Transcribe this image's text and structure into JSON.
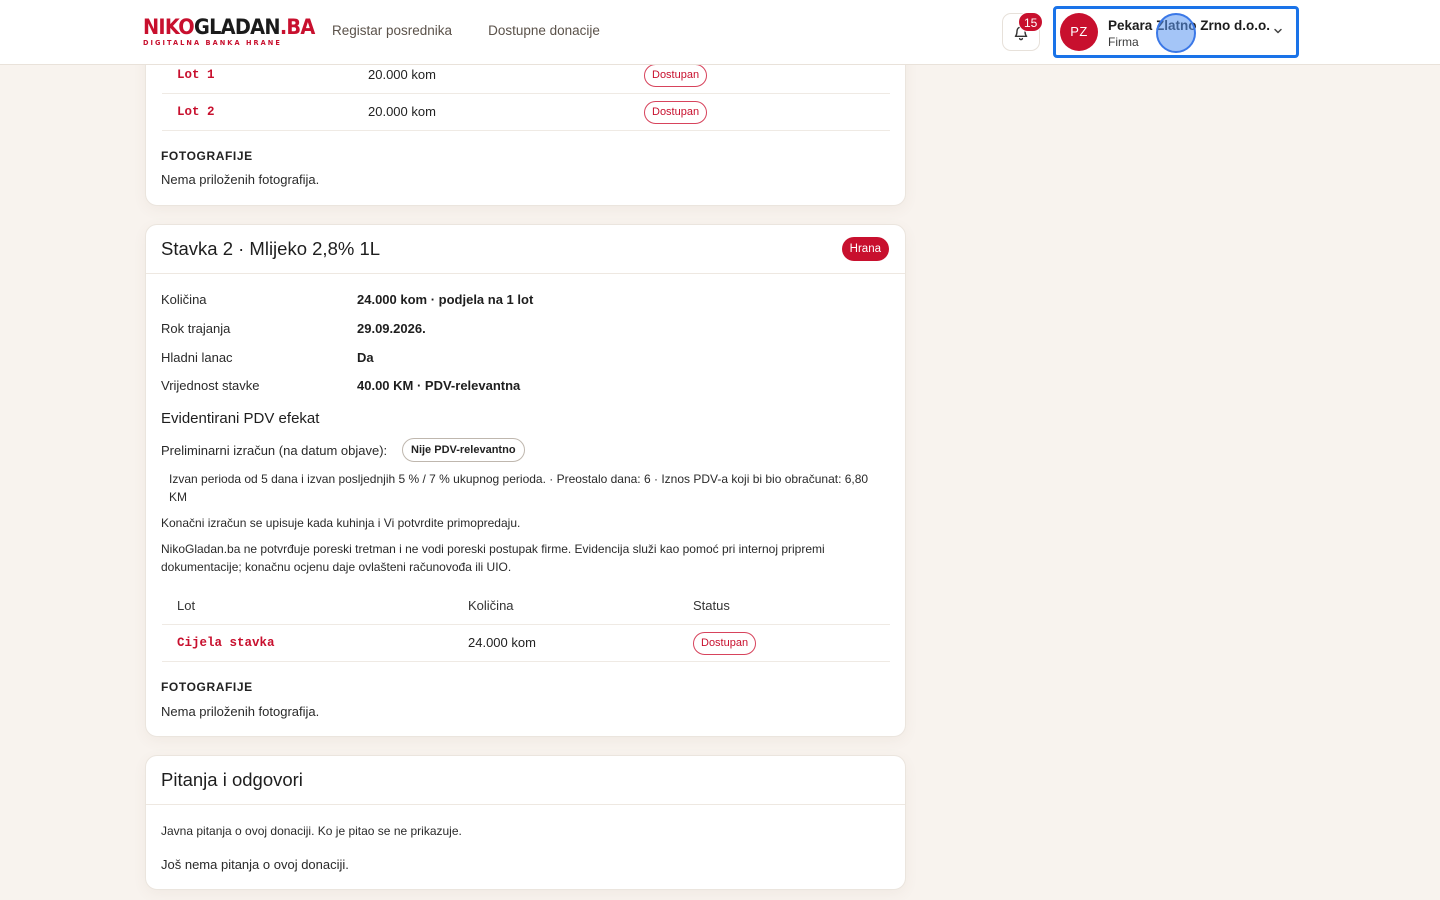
{
  "header": {
    "logo": {
      "part1": "NIKO",
      "part2": "GLADAN",
      "part3": ".BA",
      "tagline": "DIGITALNA BANKA HRANE"
    },
    "nav": [
      "Registar posrednika",
      "Dostupne donacije"
    ],
    "notifications": {
      "count": "15",
      "icon": "bell-icon"
    },
    "account": {
      "initials": "PZ",
      "name": "Pekara Zlatno Zrno d.o.o.",
      "role": "Firma"
    }
  },
  "item1": {
    "lots": [
      {
        "code": "Lot 1",
        "qty": "20.000 kom",
        "status": "Dostupan"
      },
      {
        "code": "Lot 2",
        "qty": "20.000 kom",
        "status": "Dostupan"
      }
    ],
    "photos_label": "FOTOGRAFIJE",
    "photos_text": "Nema priloženih fotografija."
  },
  "item2": {
    "title": "Stavka 2 · Mlijeko 2,8% 1L",
    "category": "Hrana",
    "details": [
      {
        "label": "Količina",
        "value": "24.000 kom · podjela na 1 lot"
      },
      {
        "label": "Rok trajanja",
        "value": "29.09.2026."
      },
      {
        "label": "Hladni lanac",
        "value": "Da"
      },
      {
        "label": "Vrijednost stavke",
        "value": "40.00 KM · PDV-relevantna"
      }
    ],
    "vat_heading": "Evidentirani PDV efekat",
    "prelim_label": "Preliminarni izračun (na datum objave):",
    "prelim_badge": "Nije PDV-relevantno",
    "prelim_detail_1": "Izvan perioda od 5 dana i izvan posljednjih 5 % / 7 % ukupnog perioda. · Preostalo dana: 6 · Iznos PDV-a koji bi bio obračunat: 6,80",
    "prelim_detail_2": "KM",
    "final_note": "Konačni izračun se upisuje kada kuhinja i Vi potvrdite primopredaju.",
    "disclaimer_1": "NikoGladan.ba ne potvrđuje poreski tretman i ne vodi poreski postupak firme. Evidencija služi kao pomoć pri internoj pripremi",
    "disclaimer_2": "dokumentacije; konačnu ocjenu daje ovlašteni računovođa ili UIO.",
    "table_headers": {
      "lot": "Lot",
      "qty": "Količina",
      "status": "Status"
    },
    "lots": [
      {
        "code": "Cijela stavka",
        "qty": "24.000 kom",
        "status": "Dostupan"
      }
    ],
    "photos_label": "FOTOGRAFIJE",
    "photos_text": "Nema priloženih fotografija."
  },
  "qa": {
    "title": "Pitanja i odgovori",
    "intro": "Javna pitanja o ovoj donaciji. Ko je pitao se ne prikazuje.",
    "empty": "Još nema pitanja o ovoj donaciji."
  },
  "colors": {
    "brand": "#c8102e",
    "focus": "#1a73e8",
    "background": "#f8f3ee"
  }
}
